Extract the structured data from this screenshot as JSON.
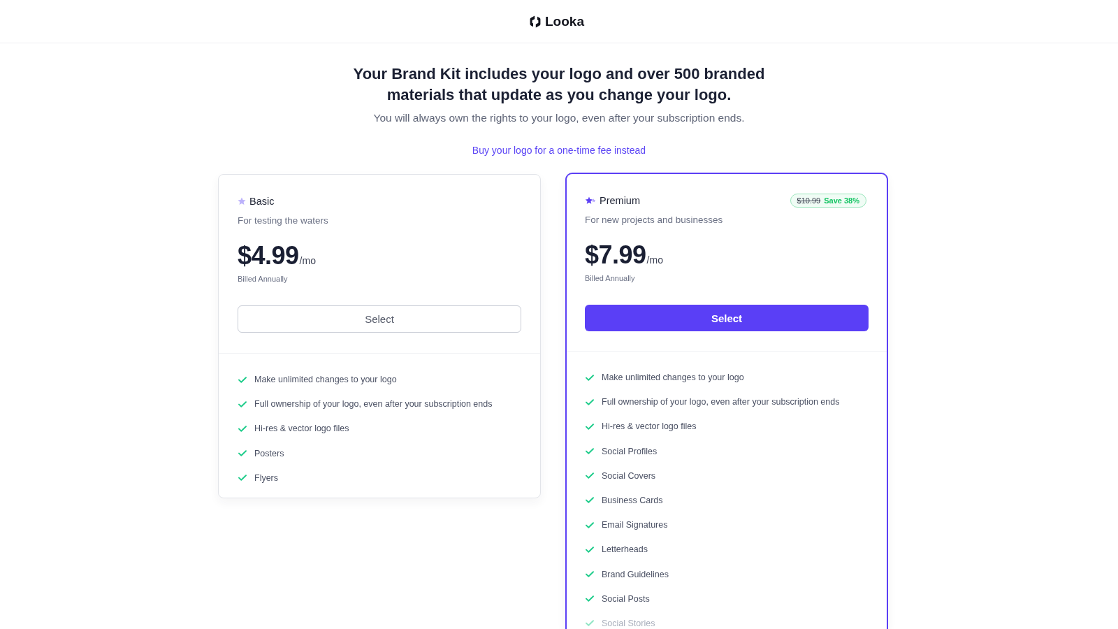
{
  "header": {
    "logo_text": "Looka"
  },
  "hero": {
    "title": "Your Brand Kit includes your logo and over 500 branded materials that update as you change your logo.",
    "subtitle": "You will always own the rights to your logo, even after your subscription ends.",
    "link": "Buy your logo for a one-time fee instead"
  },
  "plans": [
    {
      "kind": "basic",
      "highlighted": false,
      "name": "Basic",
      "tagline": "For testing the waters",
      "price": "$4.99",
      "period": "/mo",
      "billing": "Billed Annually",
      "button": "Select",
      "features": [
        {
          "label": "Make unlimited changes to your logo",
          "faded": false
        },
        {
          "label": "Full ownership of your logo, even after your subscription ends",
          "faded": false
        },
        {
          "label": "Hi-res & vector logo files",
          "faded": false
        },
        {
          "label": "Posters",
          "faded": false
        },
        {
          "label": "Flyers",
          "faded": false
        }
      ]
    },
    {
      "kind": "premium",
      "highlighted": true,
      "name": "Premium",
      "badge": {
        "old_price": "$10.99",
        "save": "Save 38%"
      },
      "tagline": "For new projects and businesses",
      "price": "$7.99",
      "period": "/mo",
      "billing": "Billed Annually",
      "button": "Select",
      "features": [
        {
          "label": "Make unlimited changes to your logo",
          "faded": false
        },
        {
          "label": "Full ownership of your logo, even after your subscription ends",
          "faded": false
        },
        {
          "label": "Hi-res & vector logo files",
          "faded": false
        },
        {
          "label": "Social Profiles",
          "faded": false
        },
        {
          "label": "Social Covers",
          "faded": false
        },
        {
          "label": "Business Cards",
          "faded": false
        },
        {
          "label": "Email Signatures",
          "faded": false
        },
        {
          "label": "Letterheads",
          "faded": false
        },
        {
          "label": "Brand Guidelines",
          "faded": false
        },
        {
          "label": "Social Posts",
          "faded": false
        },
        {
          "label": "Social Stories",
          "faded": true
        }
      ]
    }
  ]
}
